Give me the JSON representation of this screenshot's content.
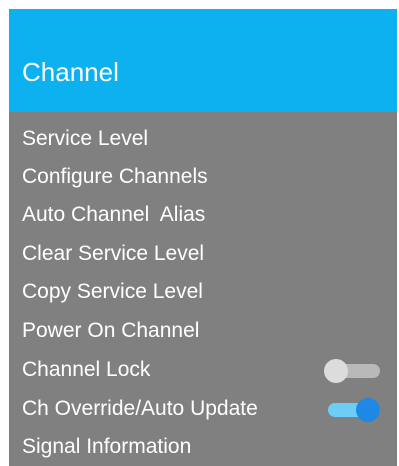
{
  "header": {
    "title": "Channel"
  },
  "menu": {
    "items": [
      {
        "label": "Service Level"
      },
      {
        "label": "Configure Channels"
      },
      {
        "label": "Auto Channel  Alias"
      },
      {
        "label": "Clear Service Level"
      },
      {
        "label": "Copy Service Level"
      },
      {
        "label": "Power On Channel"
      },
      {
        "label": "Channel Lock",
        "toggle": "off"
      },
      {
        "label": "Ch Override/Auto Update",
        "toggle": "on"
      },
      {
        "label": "Signal Information"
      }
    ]
  },
  "colors": {
    "header_background": "#0db1ef",
    "menu_background": "#808080",
    "text": "#ffffff",
    "toggle_on_track": "#6ccdf6",
    "toggle_on_knob": "#1e88e5",
    "toggle_off_track": "#b9b9b9",
    "toggle_off_knob": "#dcdcdc"
  }
}
